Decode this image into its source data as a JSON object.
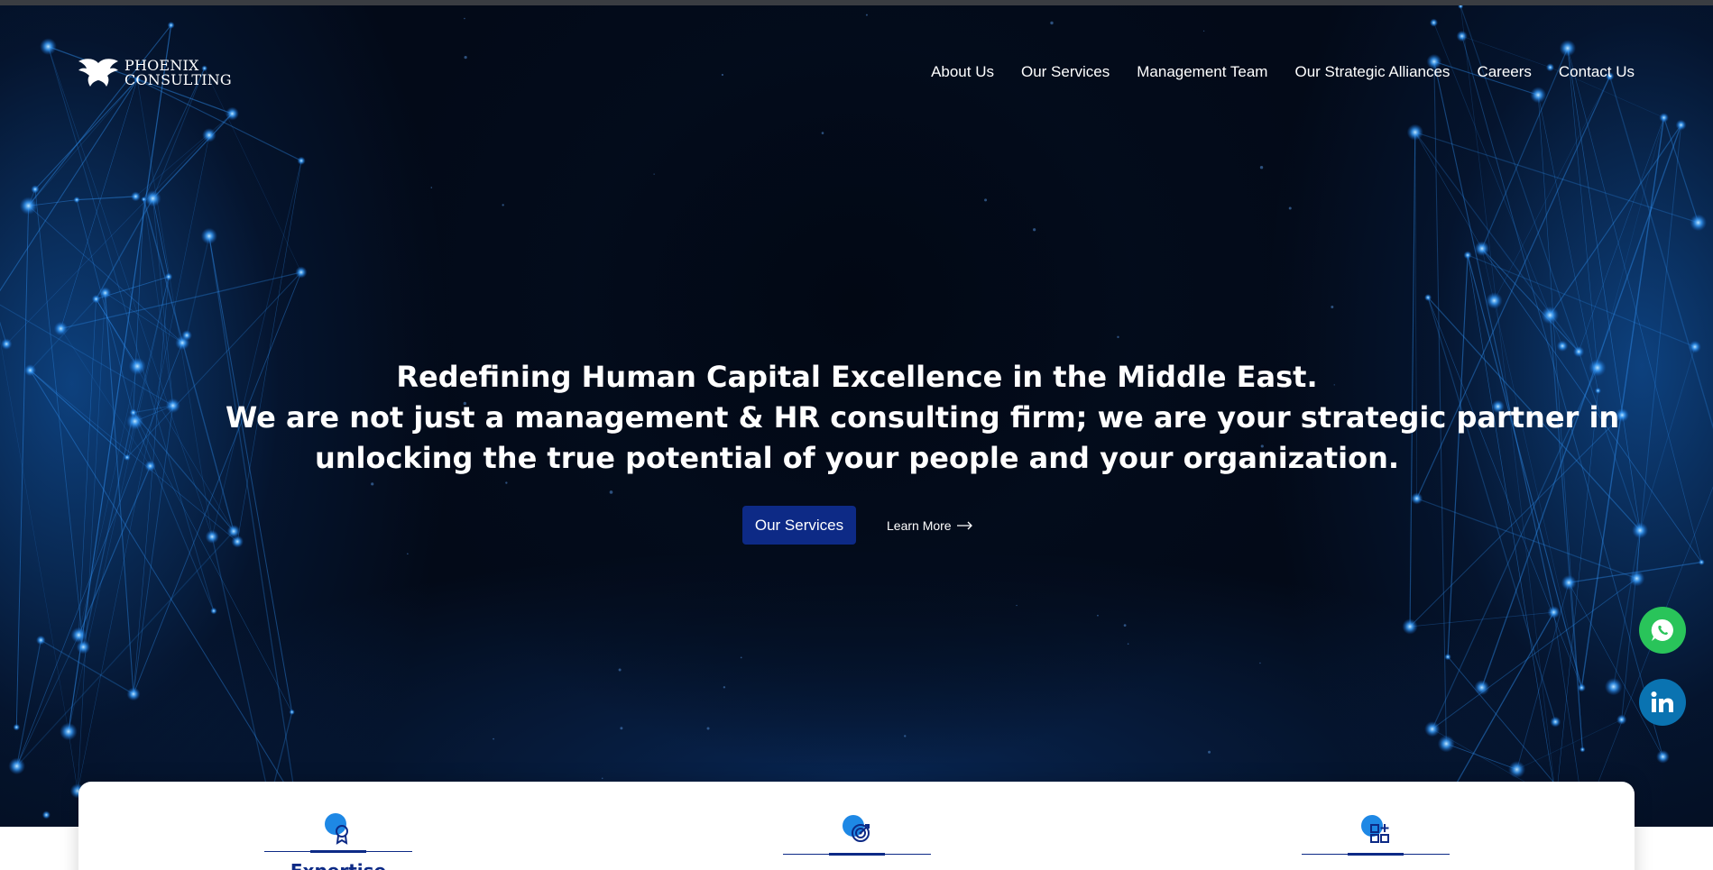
{
  "brand": {
    "name_line1": "PHOENIX",
    "name_line2": "CONSULTING"
  },
  "nav": {
    "items": [
      {
        "label": "About Us"
      },
      {
        "label": "Our Services"
      },
      {
        "label": "Management Team"
      },
      {
        "label": "Our Strategic Alliances"
      },
      {
        "label": "Careers"
      },
      {
        "label": "Contact Us"
      }
    ]
  },
  "hero": {
    "line1": "Redefining Human Capital Excellence in the Middle East.",
    "line2": "We are not just a management & HR consulting firm; we are your strategic partner in",
    "line3": "unlocking the true potential of your people and your organization.",
    "primary_button": "Our Services",
    "secondary_link": "Learn More",
    "secondary_link_icon": "arrow-right-icon"
  },
  "floating": {
    "whatsapp_icon": "whatsapp-icon",
    "linkedin_icon": "linkedin-icon"
  },
  "features": [
    {
      "title": "Expertise",
      "icon": "award-badge-icon"
    },
    {
      "title": "",
      "icon": "target-icon"
    },
    {
      "title": "",
      "icon": "apps-grid-plus-icon"
    }
  ],
  "colors": {
    "hero_bg": "#030a18",
    "primary_button": "#0d2a86",
    "accent_blue": "#1e88e5",
    "whatsapp": "#29c45a",
    "linkedin": "#0a73b1"
  }
}
